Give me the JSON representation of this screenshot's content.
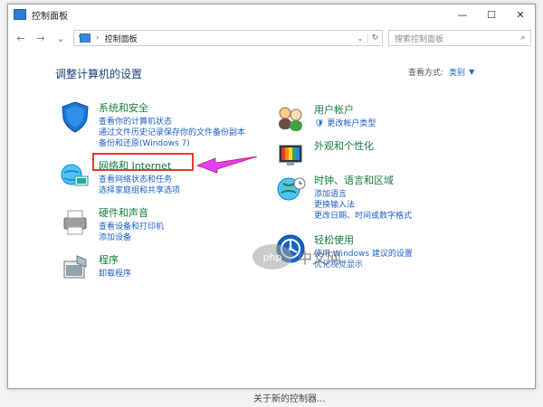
{
  "window": {
    "title": "控制面板",
    "minimize": "—",
    "maximize": "☐",
    "close": "✕"
  },
  "nav": {
    "back": "←",
    "forward": "→",
    "recent": "⌄",
    "up": "↑",
    "breadcrumb": "控制面板",
    "refresh": "↻",
    "search_placeholder": "搜索控制面板",
    "search_icon": "⌕"
  },
  "header": {
    "title": "调整计算机的设置",
    "view_by_label": "查看方式:",
    "view_by_value": "类别"
  },
  "categories": [
    {
      "title": "系统和安全",
      "links": [
        "查看你的计算机状态",
        "通过文件历史记录保存你的文件备份副本",
        "备份和还原(Windows 7)"
      ],
      "icon": "shield-icon"
    },
    {
      "title": "网络和 Internet",
      "links": [
        "查看网络状态和任务",
        "选择家庭组和共享选项"
      ],
      "icon": "network-icon"
    },
    {
      "title": "硬件和声音",
      "links": [
        "查看设备和打印机",
        "添加设备"
      ],
      "icon": "printer-icon"
    },
    {
      "title": "程序",
      "links": [
        "卸载程序"
      ],
      "icon": "program-icon"
    },
    {
      "title": "用户帐户",
      "links": [
        "更改帐户类型"
      ],
      "icon": "users-icon"
    },
    {
      "title": "外观和个性化",
      "links": [],
      "icon": "appearance-icon"
    },
    {
      "title": "时钟、语言和区域",
      "links": [
        "添加语言",
        "更换输入法",
        "更改日期、时间或数字格式"
      ],
      "icon": "globe-clock-icon"
    },
    {
      "title": "轻松使用",
      "links": [
        "使用 Windows 建议的设置",
        "优化视觉显示"
      ],
      "icon": "accessibility-icon"
    }
  ],
  "watermark": {
    "badge": "php",
    "text": "中文网"
  },
  "bottom": {
    "text": "关于新的控制器..."
  }
}
